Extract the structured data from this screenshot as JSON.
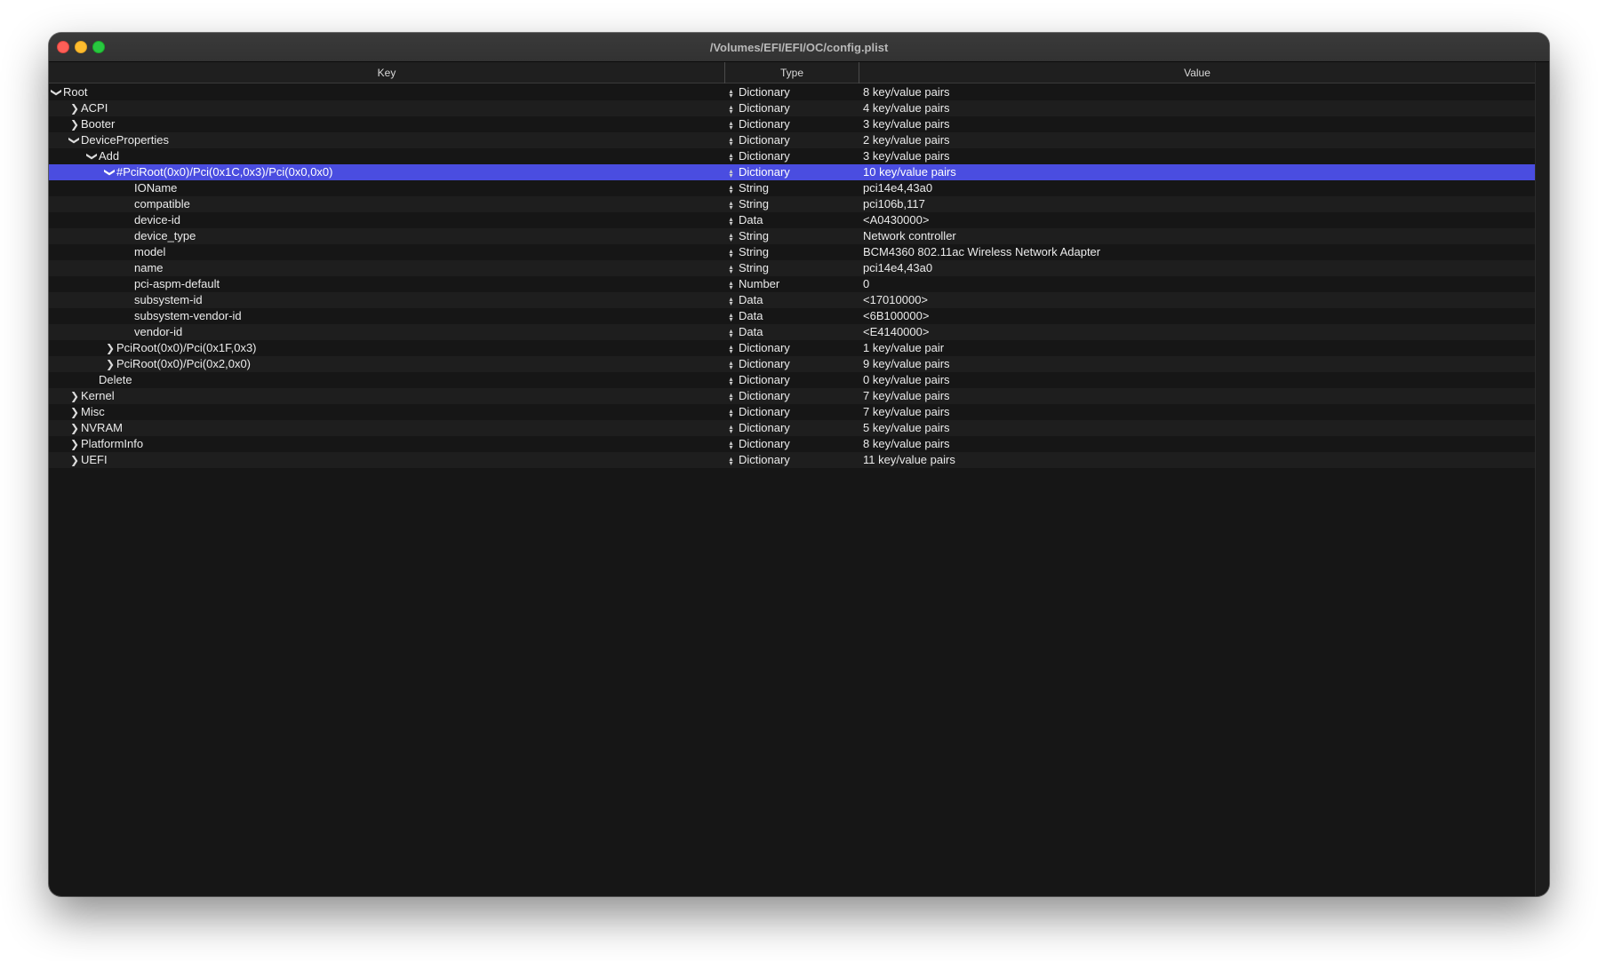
{
  "window": {
    "title": "/Volumes/EFI/EFI/OC/config.plist"
  },
  "columns": {
    "key": "Key",
    "type": "Type",
    "value": "Value"
  },
  "rows": [
    {
      "key": "Root",
      "type": "Dictionary",
      "value": "8 key/value pairs",
      "depth": 0,
      "disclosure": "open"
    },
    {
      "key": "ACPI",
      "type": "Dictionary",
      "value": "4 key/value pairs",
      "depth": 1,
      "disclosure": "closed"
    },
    {
      "key": "Booter",
      "type": "Dictionary",
      "value": "3 key/value pairs",
      "depth": 1,
      "disclosure": "closed"
    },
    {
      "key": "DeviceProperties",
      "type": "Dictionary",
      "value": "2 key/value pairs",
      "depth": 1,
      "disclosure": "open"
    },
    {
      "key": "Add",
      "type": "Dictionary",
      "value": "3 key/value pairs",
      "depth": 2,
      "disclosure": "open"
    },
    {
      "key": "#PciRoot(0x0)/Pci(0x1C,0x3)/Pci(0x0,0x0)",
      "type": "Dictionary",
      "value": "10 key/value pairs",
      "depth": 3,
      "disclosure": "open",
      "selected": true
    },
    {
      "key": "IOName",
      "type": "String",
      "value": "pci14e4,43a0",
      "depth": 4,
      "disclosure": "none"
    },
    {
      "key": "compatible",
      "type": "String",
      "value": "pci106b,117",
      "depth": 4,
      "disclosure": "none"
    },
    {
      "key": "device-id",
      "type": "Data",
      "value": "<A0430000>",
      "depth": 4,
      "disclosure": "none"
    },
    {
      "key": "device_type",
      "type": "String",
      "value": "Network controller",
      "depth": 4,
      "disclosure": "none"
    },
    {
      "key": "model",
      "type": "String",
      "value": "BCM4360 802.11ac Wireless Network Adapter",
      "depth": 4,
      "disclosure": "none"
    },
    {
      "key": "name",
      "type": "String",
      "value": "pci14e4,43a0",
      "depth": 4,
      "disclosure": "none"
    },
    {
      "key": "pci-aspm-default",
      "type": "Number",
      "value": "0",
      "depth": 4,
      "disclosure": "none"
    },
    {
      "key": "subsystem-id",
      "type": "Data",
      "value": "<17010000>",
      "depth": 4,
      "disclosure": "none"
    },
    {
      "key": "subsystem-vendor-id",
      "type": "Data",
      "value": "<6B100000>",
      "depth": 4,
      "disclosure": "none"
    },
    {
      "key": "vendor-id",
      "type": "Data",
      "value": "<E4140000>",
      "depth": 4,
      "disclosure": "none"
    },
    {
      "key": "PciRoot(0x0)/Pci(0x1F,0x3)",
      "type": "Dictionary",
      "value": "1 key/value pair",
      "depth": 3,
      "disclosure": "closed"
    },
    {
      "key": "PciRoot(0x0)/Pci(0x2,0x0)",
      "type": "Dictionary",
      "value": "9 key/value pairs",
      "depth": 3,
      "disclosure": "closed"
    },
    {
      "key": "Delete",
      "type": "Dictionary",
      "value": "0 key/value pairs",
      "depth": 2,
      "disclosure": "none"
    },
    {
      "key": "Kernel",
      "type": "Dictionary",
      "value": "7 key/value pairs",
      "depth": 1,
      "disclosure": "closed"
    },
    {
      "key": "Misc",
      "type": "Dictionary",
      "value": "7 key/value pairs",
      "depth": 1,
      "disclosure": "closed"
    },
    {
      "key": "NVRAM",
      "type": "Dictionary",
      "value": "5 key/value pairs",
      "depth": 1,
      "disclosure": "closed"
    },
    {
      "key": "PlatformInfo",
      "type": "Dictionary",
      "value": "8 key/value pairs",
      "depth": 1,
      "disclosure": "closed"
    },
    {
      "key": "UEFI",
      "type": "Dictionary",
      "value": "11 key/value pairs",
      "depth": 1,
      "disclosure": "closed"
    }
  ]
}
